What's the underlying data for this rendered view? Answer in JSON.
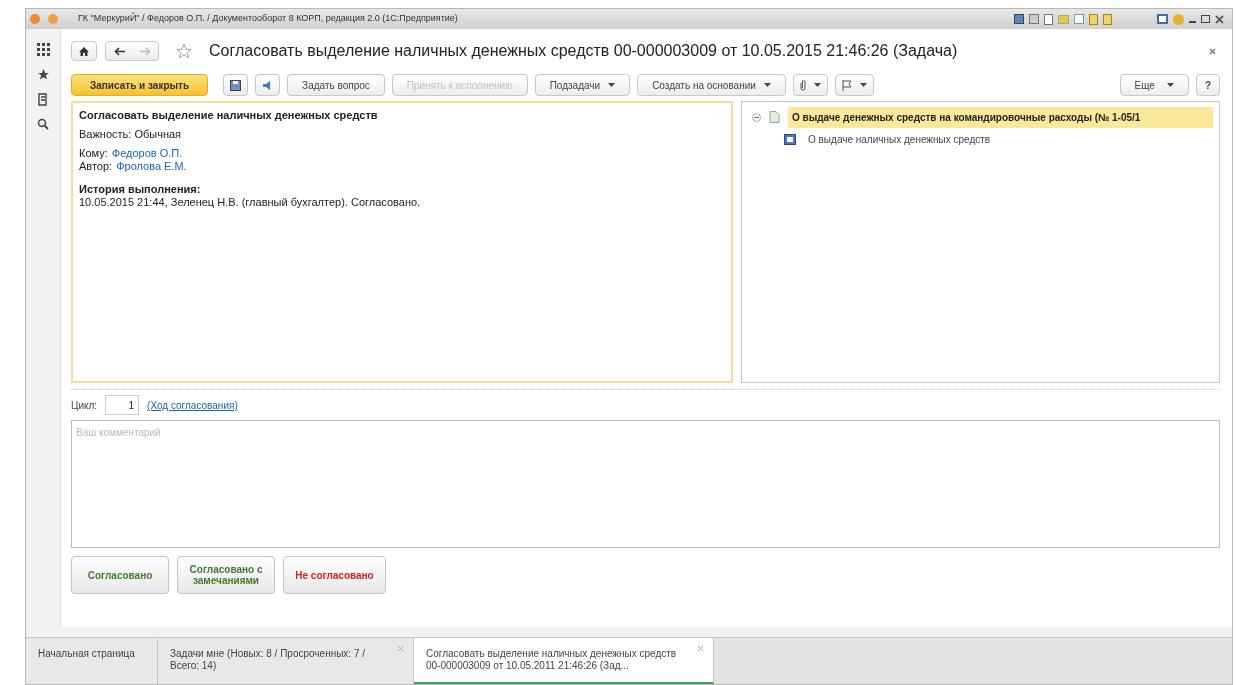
{
  "window": {
    "title": "ГК \"МеркуриЙ\" / Федоров О.П. / Документооборот 8 КОРП, редакция 2.0  (1С:Предприятие)"
  },
  "form": {
    "title": "Согласовать выделение наличных денежных средств 00-000003009 от 10.05.2015 21:46:26 (Задача)"
  },
  "toolbar": [
    {
      "kind": "primary",
      "label": "Записать и закрыть",
      "disabled": false,
      "dropdown": false
    },
    {
      "kind": "save-icon",
      "disabled": false,
      "dropdown": false
    },
    {
      "kind": "sound-icon",
      "disabled": false,
      "dropdown": false
    },
    {
      "kind": "text",
      "label": "Задать вопрос",
      "disabled": false,
      "dropdown": false
    },
    {
      "kind": "text",
      "label": "Принять к исполнению",
      "disabled": true,
      "dropdown": false
    },
    {
      "kind": "text",
      "label": "Подзадачи",
      "disabled": false,
      "dropdown": true
    },
    {
      "kind": "text",
      "label": "Создать на основании",
      "disabled": false,
      "dropdown": true
    },
    {
      "kind": "clip-icon",
      "disabled": false,
      "dropdown": true
    },
    {
      "kind": "flag-icon",
      "disabled": false,
      "dropdown": true
    }
  ],
  "toolbar_right": [
    {
      "label": "Еще",
      "dropdown": true
    },
    {
      "label": "?",
      "dropdown": false
    }
  ],
  "task": {
    "heading": "Согласовать выделение наличных денежных средств",
    "importance": "Важность: Обычная",
    "to_label": "Кому:",
    "to": "Федоров О.П.",
    "author_label": "Автор:",
    "author": "Фролова Е.М.",
    "history_heading": "История выполнения:",
    "history": "10.05.2015 21:44, Зеленец Н.В. (главный бухгалтер). Согласовано."
  },
  "tree": [
    {
      "label": "О выдаче денежных средств на командировочные расходы (№ 1-05/1",
      "selected": true,
      "expanded": true,
      "children": [
        {
          "label": "О выдаче наличных денежных средств",
          "selected": false
        }
      ]
    }
  ],
  "cycle": {
    "label": "Цикл:",
    "value": "1",
    "link": "(Ход согласования)"
  },
  "comment": {
    "placeholder": "Ваш комментарий"
  },
  "actions": [
    {
      "kind": "approve",
      "label": "Согласовано"
    },
    {
      "kind": "approve",
      "label": "Согласовано с замечаниями"
    },
    {
      "kind": "reject",
      "label": "Не согласовано"
    }
  ],
  "tabs": [
    {
      "label": "Начальная страница",
      "selected": false,
      "closable": false
    },
    {
      "label": "Задачи мне (Новых: 8 / Просроченных: 7 / Всего: 14)",
      "selected": false,
      "closable": true
    },
    {
      "label": "Согласовать выделение наличных денежных средств 00-000003009 от 10.05.2011 21:46:26 (Зад...",
      "selected": true,
      "closable": true
    }
  ]
}
